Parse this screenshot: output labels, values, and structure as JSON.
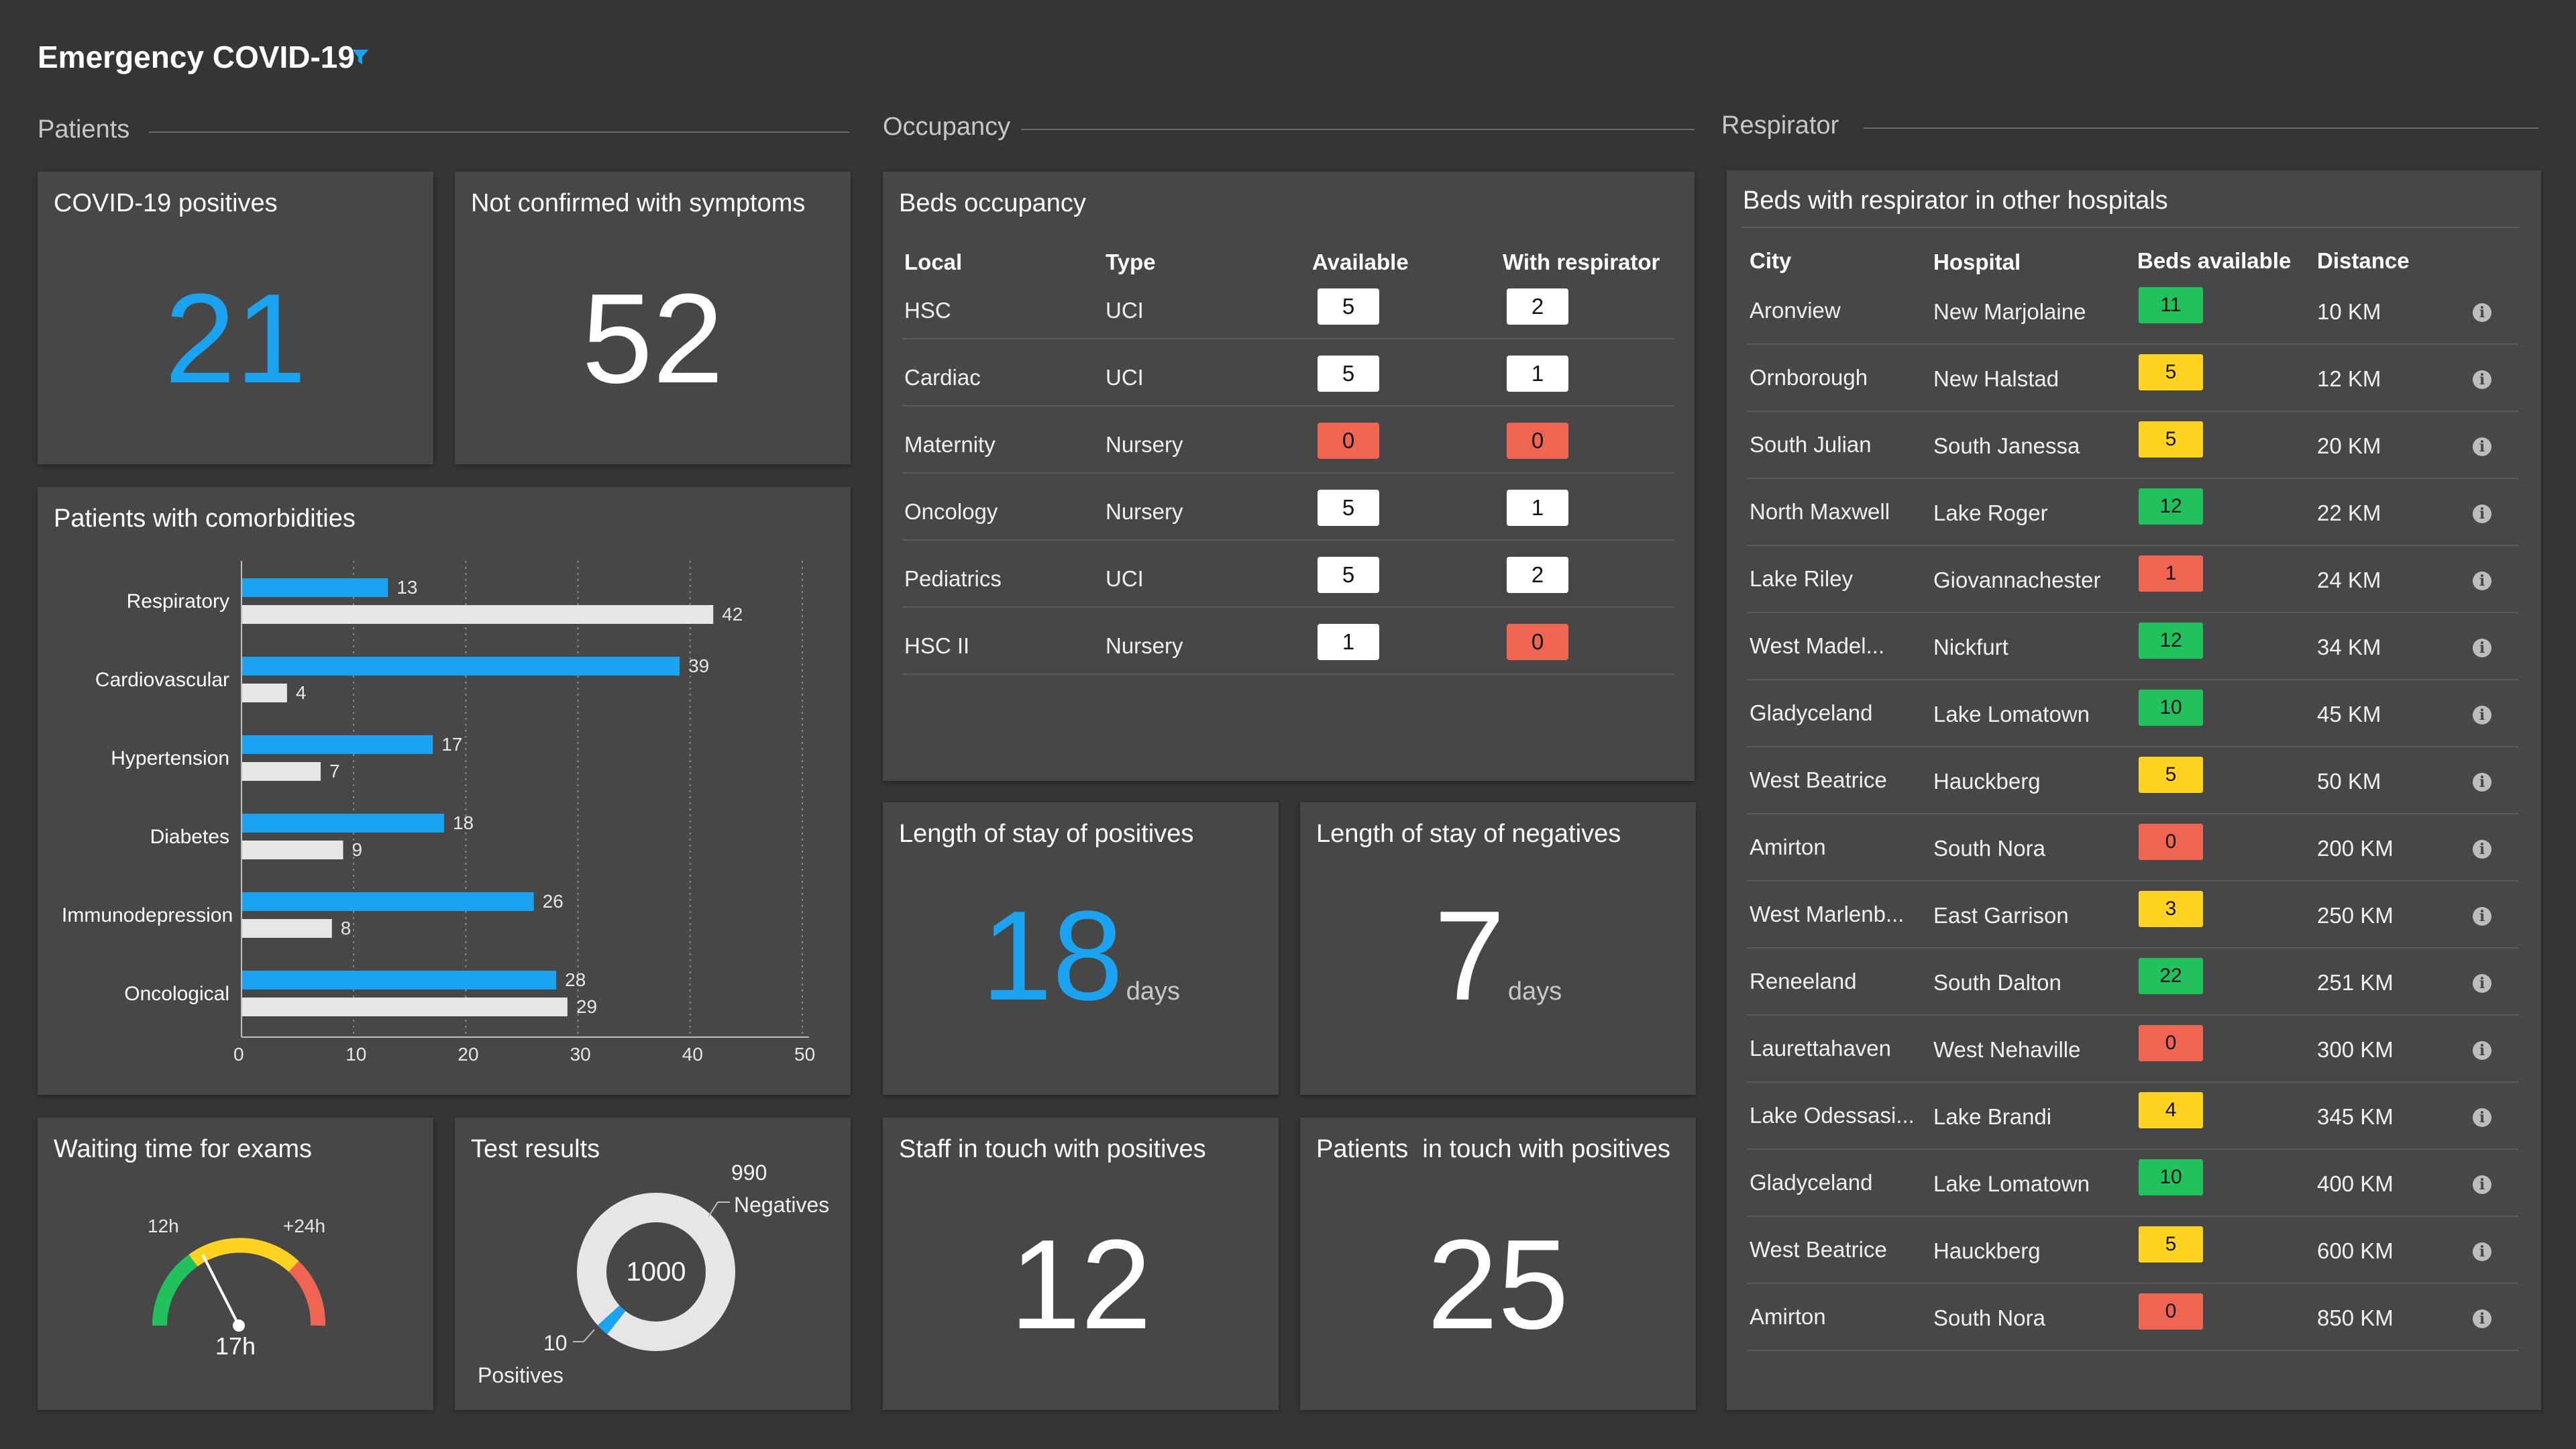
{
  "header": {
    "title": "Emergency COVID-19"
  },
  "sections": {
    "patients": "Patients",
    "occupancy": "Occupancy",
    "respirator": "Respirator"
  },
  "kpis": {
    "covid_positives": {
      "label": "COVID-19 positives",
      "value": "21"
    },
    "not_confirmed": {
      "label": "Not confirmed with symptoms",
      "value": "52"
    },
    "stay_positives": {
      "label": "Length of stay of positives",
      "value": "18",
      "unit": "days"
    },
    "stay_negatives": {
      "label": "Length of stay of negatives",
      "value": "7",
      "unit": "days"
    },
    "staff_touch": {
      "label": "Staff in touch with positives",
      "value": "12"
    },
    "patients_touch": {
      "label": "Patients  in touch with positives",
      "value": "25"
    }
  },
  "comorbidities": {
    "title": "Patients with comorbidities",
    "chart_data": {
      "type": "bar",
      "orientation": "horizontal",
      "categories": [
        "Respiratory",
        "Cardiovascular",
        "Hypertension",
        "Diabetes",
        "Immunodepression",
        "Oncological"
      ],
      "series": [
        {
          "values": [
            13,
            39,
            17,
            18,
            26,
            28
          ],
          "color": "#1aa3f0"
        },
        {
          "values": [
            42,
            4,
            7,
            9,
            8,
            29
          ],
          "color": "#e6e6e6"
        }
      ],
      "xticks": [
        "0",
        "10",
        "20",
        "30",
        "40",
        "50"
      ],
      "xlim": [
        0,
        50
      ],
      "grid": "dotted vertical"
    }
  },
  "waiting": {
    "title": "Waiting time for exams",
    "label_12h": "12h",
    "label_24h": "+24h",
    "value": "17h",
    "gauge_fraction": 0.35
  },
  "tests": {
    "title": "Test results",
    "total": "1000",
    "negatives_value": "990",
    "negatives_label": "Negatives",
    "positives_value": "10",
    "positives_label": "Positives",
    "chart_data": {
      "type": "pie",
      "slices": [
        {
          "label": "Negatives",
          "value": 990,
          "color": "#e6e6e6"
        },
        {
          "label": "Positives",
          "value": 10,
          "color": "#1aa3f0"
        }
      ]
    }
  },
  "beds": {
    "title": "Beds occupancy",
    "headers": [
      "Local",
      "Type",
      "Available",
      "With respirator"
    ],
    "rows": [
      {
        "local": "HSC",
        "type": "UCI",
        "available": "5",
        "respirator": "2",
        "av_color": "white",
        "re_color": "white"
      },
      {
        "local": "Cardiac",
        "type": "UCI",
        "available": "5",
        "respirator": "1",
        "av_color": "white",
        "re_color": "white"
      },
      {
        "local": "Maternity",
        "type": "Nursery",
        "available": "0",
        "respirator": "0",
        "av_color": "red",
        "re_color": "red"
      },
      {
        "local": "Oncology",
        "type": "Nursery",
        "available": "5",
        "respirator": "1",
        "av_color": "white",
        "re_color": "white"
      },
      {
        "local": "Pediatrics",
        "type": "UCI",
        "available": "5",
        "respirator": "2",
        "av_color": "white",
        "re_color": "white"
      },
      {
        "local": "HSC II",
        "type": "Nursery",
        "available": "1",
        "respirator": "0",
        "av_color": "white",
        "re_color": "red"
      }
    ]
  },
  "hospitals": {
    "title": "Beds with respirator in other hospitals",
    "headers": [
      "City",
      "Hospital",
      "Beds available",
      "Distance"
    ],
    "colors": {
      "green": "#21c25e",
      "yellow": "#ffd31f",
      "red": "#f06552"
    },
    "rows": [
      {
        "city": "Aronview",
        "hospital": "New Marjolaine",
        "beds": "11",
        "color": "green",
        "distance": "10 KM"
      },
      {
        "city": "Ornborough",
        "hospital": "New Halstad",
        "beds": "5",
        "color": "yellow",
        "distance": "12 KM"
      },
      {
        "city": "South Julian",
        "hospital": "South Janessa",
        "beds": "5",
        "color": "yellow",
        "distance": "20 KM"
      },
      {
        "city": "North Maxwell",
        "hospital": "Lake Roger",
        "beds": "12",
        "color": "green",
        "distance": "22 KM"
      },
      {
        "city": "Lake Riley",
        "hospital": "Giovannachester",
        "beds": "1",
        "color": "red",
        "distance": "24 KM"
      },
      {
        "city": "West Madel...",
        "hospital": "Nickfurt",
        "beds": "12",
        "color": "green",
        "distance": "34 KM"
      },
      {
        "city": "Gladyceland",
        "hospital": "Lake Lomatown",
        "beds": "10",
        "color": "green",
        "distance": "45 KM"
      },
      {
        "city": "West Beatrice",
        "hospital": "Hauckberg",
        "beds": "5",
        "color": "yellow",
        "distance": "50 KM"
      },
      {
        "city": "Amirton",
        "hospital": "South Nora",
        "beds": "0",
        "color": "red",
        "distance": "200 KM"
      },
      {
        "city": "West Marlenb...",
        "hospital": "East Garrison",
        "beds": "3",
        "color": "yellow",
        "distance": "250 KM"
      },
      {
        "city": "Reneeland",
        "hospital": "South Dalton",
        "beds": "22",
        "color": "green",
        "distance": "251 KM"
      },
      {
        "city": "Laurettahaven",
        "hospital": "West Nehaville",
        "beds": "0",
        "color": "red",
        "distance": "300 KM"
      },
      {
        "city": "Lake Odessasi...",
        "hospital": "Lake Brandi",
        "beds": "4",
        "color": "yellow",
        "distance": "345 KM"
      },
      {
        "city": "Gladyceland",
        "hospital": "Lake Lomatown",
        "beds": "10",
        "color": "green",
        "distance": "400 KM"
      },
      {
        "city": "West Beatrice",
        "hospital": "Hauckberg",
        "beds": "5",
        "color": "yellow",
        "distance": "600 KM"
      },
      {
        "city": "Amirton",
        "hospital": "South Nora",
        "beds": "0",
        "color": "red",
        "distance": "850 KM"
      }
    ]
  }
}
